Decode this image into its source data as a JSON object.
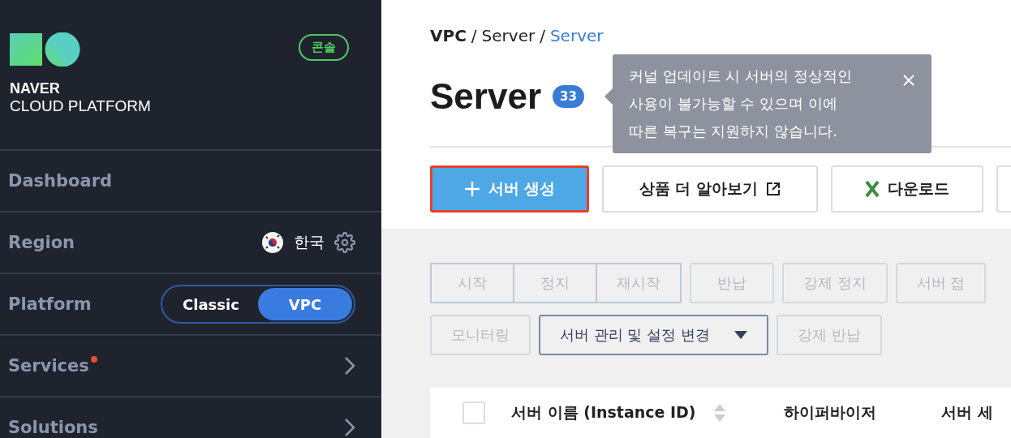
{
  "sidebar": {
    "logo": {
      "line_1": "NAVER",
      "line_2": "CLOUD PLATFORM"
    },
    "console_badge": "콘솔",
    "items": [
      {
        "kind": "link",
        "label": "Dashboard"
      },
      {
        "kind": "region",
        "label": "Region",
        "value": "한국"
      },
      {
        "kind": "toggle",
        "label": "Platform",
        "options": [
          {
            "label": "Classic",
            "selected": false
          },
          {
            "label": "VPC",
            "selected": true
          }
        ]
      },
      {
        "kind": "menu",
        "label": "Services",
        "notice": true
      },
      {
        "kind": "menu",
        "label": "Solutions",
        "notice": false
      }
    ]
  },
  "breadcrumb": [
    {
      "label": "VPC",
      "current": false,
      "bold": true,
      "separator": "/"
    },
    {
      "label": "Server",
      "current": false,
      "bold": false,
      "separator": "/"
    },
    {
      "label": "Server",
      "current": true,
      "bold": false
    }
  ],
  "page_title": "Server",
  "count": "33",
  "tooltip": {
    "lines": [
      "커널 업데이트 시 서버의 정상적인",
      "사용이 불가능할 수 있으며 이에",
      "따른 복구는 지원하지 않습니다."
    ]
  },
  "toolbar": [
    {
      "kind": "create",
      "label": "서버 생성",
      "focused": true
    },
    {
      "kind": "external",
      "label": "상품 더 알아보기"
    },
    {
      "kind": "excel",
      "label": "다운로드"
    },
    {
      "kind": "blank"
    }
  ],
  "actions": [
    [
      {
        "label": "시작",
        "disabled": true,
        "group": true
      },
      {
        "label": "정지",
        "disabled": true,
        "group": true
      },
      {
        "label": "재시작",
        "disabled": true,
        "group": true
      },
      {
        "label": "반납",
        "disabled": true,
        "group": false
      },
      {
        "label": "강제 정지",
        "disabled": true,
        "group": false
      },
      {
        "label": "서버 접",
        "disabled": true,
        "group": false
      }
    ],
    [
      {
        "label": "모니터링",
        "disabled": true,
        "group": false
      },
      {
        "label": "서버 관리 및 설정 변경",
        "disabled": false,
        "group": false,
        "dropdown": true
      },
      {
        "label": "강제 반납",
        "disabled": true,
        "group": false
      }
    ]
  ],
  "table": {
    "select_all_checked": false,
    "columns": [
      {
        "label": "서버 이름 (Instance ID)",
        "sortable": true
      },
      {
        "label": "하이퍼바이저",
        "sortable": false
      },
      {
        "label": "서버 세",
        "sortable": false
      }
    ]
  }
}
